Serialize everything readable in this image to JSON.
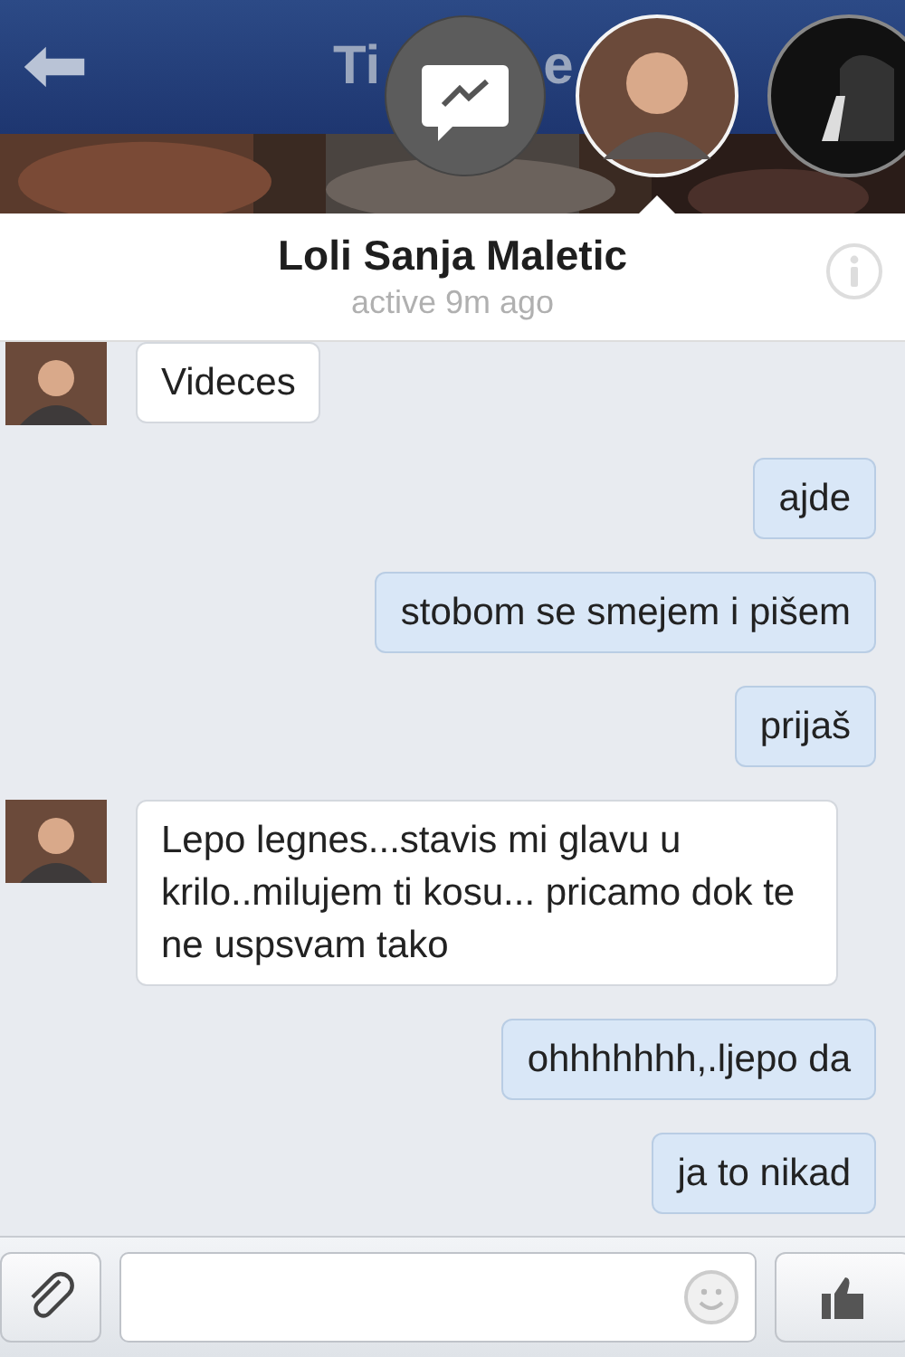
{
  "top_bar": {
    "title_parts": [
      "Ti",
      "e"
    ]
  },
  "chat_heads": [
    {
      "kind": "messenger",
      "selected": false
    },
    {
      "kind": "avatar",
      "selected": true
    },
    {
      "kind": "avatar_dark",
      "selected": false
    }
  ],
  "contact": {
    "name": "Loli Sanja Maletic",
    "status": "active 9m ago"
  },
  "messages": [
    {
      "kind": "incoming",
      "text": "Videces"
    },
    {
      "kind": "outgoing",
      "text": "ajde"
    },
    {
      "kind": "outgoing",
      "text": "stobom se smejem i pišem"
    },
    {
      "kind": "outgoing",
      "text": "prijaš"
    },
    {
      "kind": "incoming",
      "text": "Lepo legnes...stavis mi glavu u krilo..milujem ti kosu... pricamo dok te ne uspsvam tako"
    },
    {
      "kind": "outgoing",
      "text": "ohhhhhhh,.ljepo da"
    },
    {
      "kind": "outgoing",
      "text": "ja to nikad"
    }
  ]
}
